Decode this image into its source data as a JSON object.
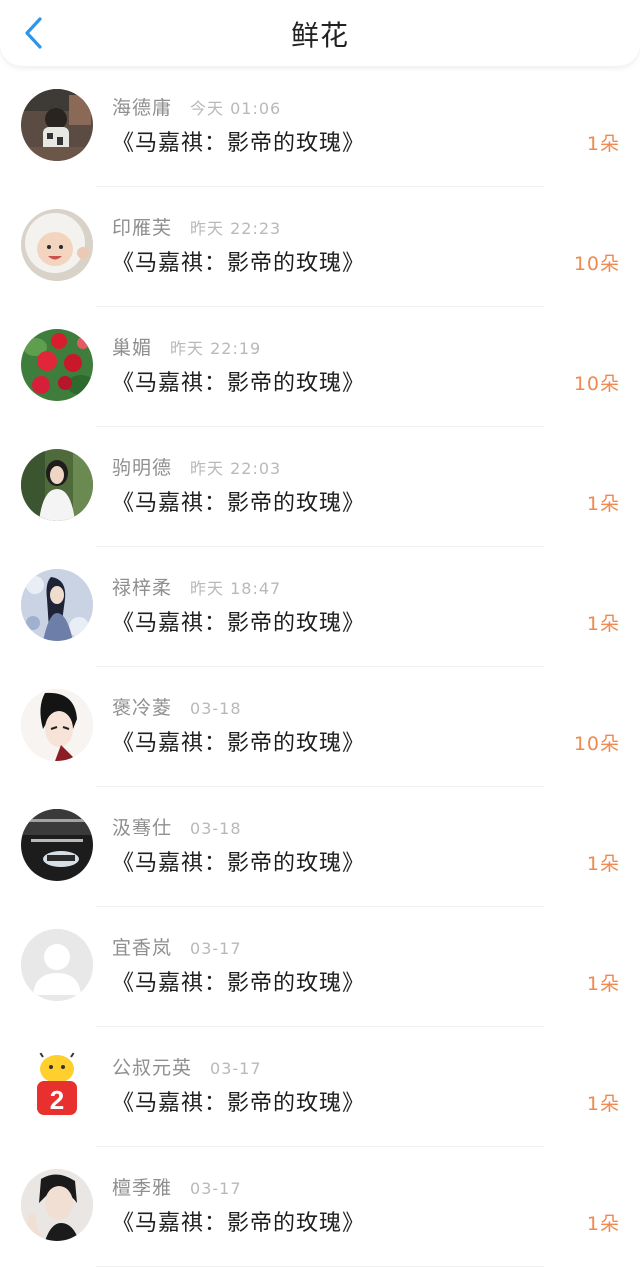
{
  "header": {
    "title": "鲜花",
    "back_icon": "chevron-left-icon",
    "back_color": "#2f95e8"
  },
  "colors": {
    "count": "#f0894f",
    "name": "#8f8f8f",
    "time": "#b9b9b9"
  },
  "items": [
    {
      "name": "海德庸",
      "time": "今天 01:06",
      "gift": "《马嘉祺：影帝的玫瑰》",
      "count": "1朵",
      "avatar": "photo-child-outdoor"
    },
    {
      "name": "印雁芙",
      "time": "昨天 22:23",
      "gift": "《马嘉祺：影帝的玫瑰》",
      "count": "10朵",
      "avatar": "photo-baby-white-hat"
    },
    {
      "name": "巢媚",
      "time": "昨天 22:19",
      "gift": "《马嘉祺：影帝的玫瑰》",
      "count": "10朵",
      "avatar": "photo-red-roses"
    },
    {
      "name": "驹明德",
      "time": "昨天 22:03",
      "gift": "《马嘉祺：影帝的玫瑰》",
      "count": "1朵",
      "avatar": "photo-girl-forest"
    },
    {
      "name": "禄梓柔",
      "time": "昨天 18:47",
      "gift": "《马嘉祺：影帝的玫瑰》",
      "count": "1朵",
      "avatar": "photo-anime-flowers"
    },
    {
      "name": "褒冷菱",
      "time": "03-18",
      "gift": "《马嘉祺：影帝的玫瑰》",
      "count": "10朵",
      "avatar": "photo-anime-boy"
    },
    {
      "name": "汲骞仕",
      "time": "03-18",
      "gift": "《马嘉祺：影帝的玫瑰》",
      "count": "1朵",
      "avatar": "photo-dark-text"
    },
    {
      "name": "宜香岚",
      "time": "03-17",
      "gift": "《马嘉祺：影帝的玫瑰》",
      "count": "1朵",
      "avatar": "default-avatar"
    },
    {
      "name": "公叔元英",
      "time": "03-17",
      "gift": "《马嘉祺：影帝的玫瑰》",
      "count": "1朵",
      "avatar": "badge-number-2"
    },
    {
      "name": "檀季雅",
      "time": "03-17",
      "gift": "《马嘉祺：影帝的玫瑰》",
      "count": "1朵",
      "avatar": "photo-boy-peace-sign"
    }
  ],
  "badge_label": "2"
}
